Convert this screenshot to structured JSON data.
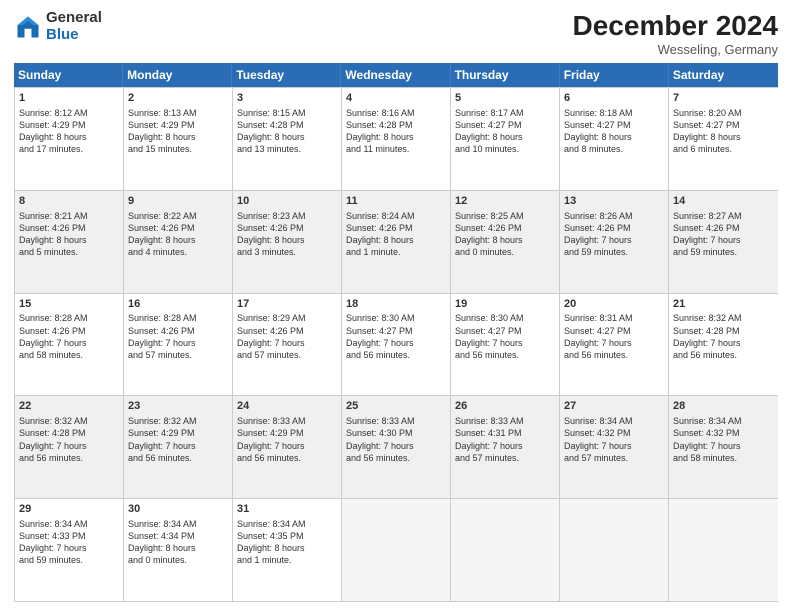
{
  "logo": {
    "general": "General",
    "blue": "Blue"
  },
  "header": {
    "month": "December 2024",
    "location": "Wesseling, Germany"
  },
  "weekdays": [
    "Sunday",
    "Monday",
    "Tuesday",
    "Wednesday",
    "Thursday",
    "Friday",
    "Saturday"
  ],
  "rows": [
    [
      {
        "day": "1",
        "lines": [
          "Sunrise: 8:12 AM",
          "Sunset: 4:29 PM",
          "Daylight: 8 hours",
          "and 17 minutes."
        ]
      },
      {
        "day": "2",
        "lines": [
          "Sunrise: 8:13 AM",
          "Sunset: 4:29 PM",
          "Daylight: 8 hours",
          "and 15 minutes."
        ]
      },
      {
        "day": "3",
        "lines": [
          "Sunrise: 8:15 AM",
          "Sunset: 4:28 PM",
          "Daylight: 8 hours",
          "and 13 minutes."
        ]
      },
      {
        "day": "4",
        "lines": [
          "Sunrise: 8:16 AM",
          "Sunset: 4:28 PM",
          "Daylight: 8 hours",
          "and 11 minutes."
        ]
      },
      {
        "day": "5",
        "lines": [
          "Sunrise: 8:17 AM",
          "Sunset: 4:27 PM",
          "Daylight: 8 hours",
          "and 10 minutes."
        ]
      },
      {
        "day": "6",
        "lines": [
          "Sunrise: 8:18 AM",
          "Sunset: 4:27 PM",
          "Daylight: 8 hours",
          "and 8 minutes."
        ]
      },
      {
        "day": "7",
        "lines": [
          "Sunrise: 8:20 AM",
          "Sunset: 4:27 PM",
          "Daylight: 8 hours",
          "and 6 minutes."
        ]
      }
    ],
    [
      {
        "day": "8",
        "lines": [
          "Sunrise: 8:21 AM",
          "Sunset: 4:26 PM",
          "Daylight: 8 hours",
          "and 5 minutes."
        ]
      },
      {
        "day": "9",
        "lines": [
          "Sunrise: 8:22 AM",
          "Sunset: 4:26 PM",
          "Daylight: 8 hours",
          "and 4 minutes."
        ]
      },
      {
        "day": "10",
        "lines": [
          "Sunrise: 8:23 AM",
          "Sunset: 4:26 PM",
          "Daylight: 8 hours",
          "and 3 minutes."
        ]
      },
      {
        "day": "11",
        "lines": [
          "Sunrise: 8:24 AM",
          "Sunset: 4:26 PM",
          "Daylight: 8 hours",
          "and 1 minute."
        ]
      },
      {
        "day": "12",
        "lines": [
          "Sunrise: 8:25 AM",
          "Sunset: 4:26 PM",
          "Daylight: 8 hours",
          "and 0 minutes."
        ]
      },
      {
        "day": "13",
        "lines": [
          "Sunrise: 8:26 AM",
          "Sunset: 4:26 PM",
          "Daylight: 7 hours",
          "and 59 minutes."
        ]
      },
      {
        "day": "14",
        "lines": [
          "Sunrise: 8:27 AM",
          "Sunset: 4:26 PM",
          "Daylight: 7 hours",
          "and 59 minutes."
        ]
      }
    ],
    [
      {
        "day": "15",
        "lines": [
          "Sunrise: 8:28 AM",
          "Sunset: 4:26 PM",
          "Daylight: 7 hours",
          "and 58 minutes."
        ]
      },
      {
        "day": "16",
        "lines": [
          "Sunrise: 8:28 AM",
          "Sunset: 4:26 PM",
          "Daylight: 7 hours",
          "and 57 minutes."
        ]
      },
      {
        "day": "17",
        "lines": [
          "Sunrise: 8:29 AM",
          "Sunset: 4:26 PM",
          "Daylight: 7 hours",
          "and 57 minutes."
        ]
      },
      {
        "day": "18",
        "lines": [
          "Sunrise: 8:30 AM",
          "Sunset: 4:27 PM",
          "Daylight: 7 hours",
          "and 56 minutes."
        ]
      },
      {
        "day": "19",
        "lines": [
          "Sunrise: 8:30 AM",
          "Sunset: 4:27 PM",
          "Daylight: 7 hours",
          "and 56 minutes."
        ]
      },
      {
        "day": "20",
        "lines": [
          "Sunrise: 8:31 AM",
          "Sunset: 4:27 PM",
          "Daylight: 7 hours",
          "and 56 minutes."
        ]
      },
      {
        "day": "21",
        "lines": [
          "Sunrise: 8:32 AM",
          "Sunset: 4:28 PM",
          "Daylight: 7 hours",
          "and 56 minutes."
        ]
      }
    ],
    [
      {
        "day": "22",
        "lines": [
          "Sunrise: 8:32 AM",
          "Sunset: 4:28 PM",
          "Daylight: 7 hours",
          "and 56 minutes."
        ]
      },
      {
        "day": "23",
        "lines": [
          "Sunrise: 8:32 AM",
          "Sunset: 4:29 PM",
          "Daylight: 7 hours",
          "and 56 minutes."
        ]
      },
      {
        "day": "24",
        "lines": [
          "Sunrise: 8:33 AM",
          "Sunset: 4:29 PM",
          "Daylight: 7 hours",
          "and 56 minutes."
        ]
      },
      {
        "day": "25",
        "lines": [
          "Sunrise: 8:33 AM",
          "Sunset: 4:30 PM",
          "Daylight: 7 hours",
          "and 56 minutes."
        ]
      },
      {
        "day": "26",
        "lines": [
          "Sunrise: 8:33 AM",
          "Sunset: 4:31 PM",
          "Daylight: 7 hours",
          "and 57 minutes."
        ]
      },
      {
        "day": "27",
        "lines": [
          "Sunrise: 8:34 AM",
          "Sunset: 4:32 PM",
          "Daylight: 7 hours",
          "and 57 minutes."
        ]
      },
      {
        "day": "28",
        "lines": [
          "Sunrise: 8:34 AM",
          "Sunset: 4:32 PM",
          "Daylight: 7 hours",
          "and 58 minutes."
        ]
      }
    ],
    [
      {
        "day": "29",
        "lines": [
          "Sunrise: 8:34 AM",
          "Sunset: 4:33 PM",
          "Daylight: 7 hours",
          "and 59 minutes."
        ]
      },
      {
        "day": "30",
        "lines": [
          "Sunrise: 8:34 AM",
          "Sunset: 4:34 PM",
          "Daylight: 8 hours",
          "and 0 minutes."
        ]
      },
      {
        "day": "31",
        "lines": [
          "Sunrise: 8:34 AM",
          "Sunset: 4:35 PM",
          "Daylight: 8 hours",
          "and 1 minute."
        ]
      },
      {
        "day": "",
        "lines": []
      },
      {
        "day": "",
        "lines": []
      },
      {
        "day": "",
        "lines": []
      },
      {
        "day": "",
        "lines": []
      }
    ]
  ],
  "shaded_rows": [
    1,
    3
  ]
}
